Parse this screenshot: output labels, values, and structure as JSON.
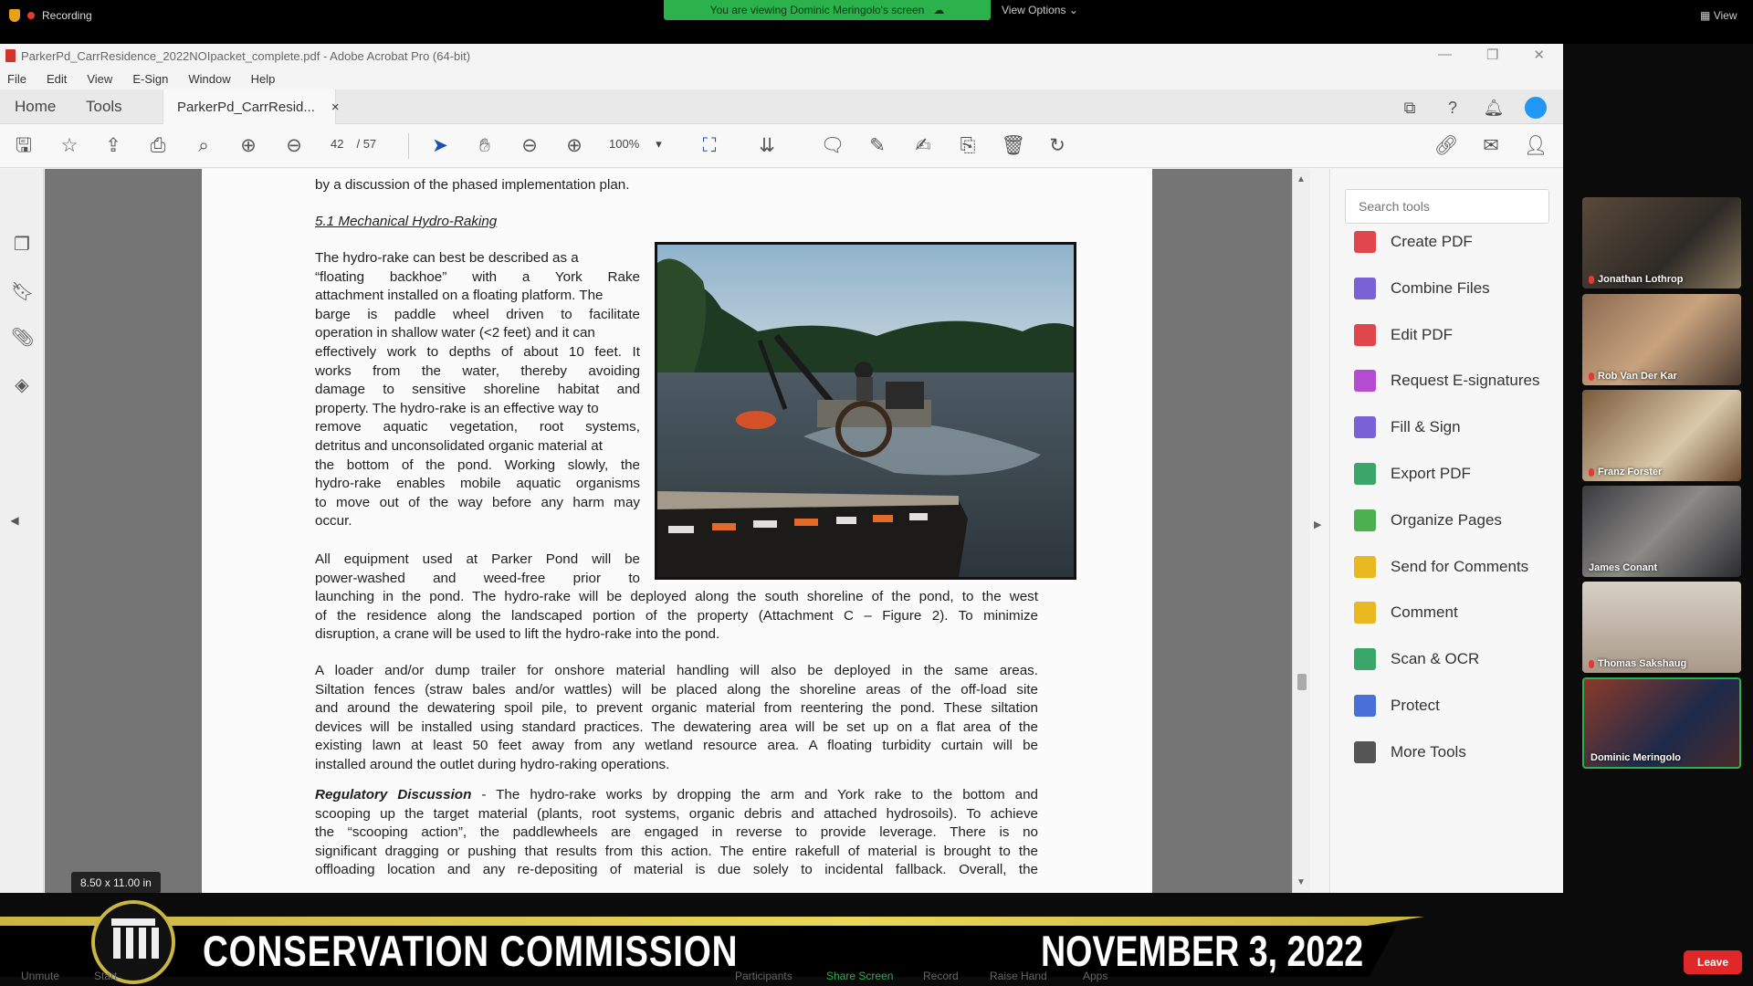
{
  "zoom": {
    "recording_label": "Recording",
    "viewing_banner": "You are viewing Dominic Meringolo's screen",
    "view_options": "View Options",
    "view": "View",
    "controls": [
      "Unmute",
      "Start",
      "Participants",
      "Share Screen",
      "Record",
      "Raise Hand",
      "Apps"
    ],
    "leave_label": "Leave",
    "participants": [
      {
        "name": "Jonathan Lothrop"
      },
      {
        "name": "Rob Van Der Kar"
      },
      {
        "name": "Franz Forster"
      },
      {
        "name": "James Conant"
      },
      {
        "name": "Thomas Sakshaug"
      },
      {
        "name": "Dominic Meringolo"
      }
    ],
    "colors": {
      "viewing_green": "#2bb24c",
      "leave_red": "#e02828",
      "muted_red": "#e53935"
    }
  },
  "acrobat": {
    "window_title": "ParkerPd_CarrResidence_2022NOIpacket_complete.pdf - Adobe Acrobat Pro (64-bit)",
    "menu": [
      "File",
      "Edit",
      "View",
      "E-Sign",
      "Window",
      "Help"
    ],
    "tabs": {
      "home": "Home",
      "tools": "Tools",
      "document": "ParkerPd_CarrResid...",
      "close": "×"
    },
    "page_current": "42",
    "page_total": "/  57",
    "zoom_level": "100%",
    "page_size_tooltip": "8.50 x 11.00 in",
    "tools_search_placeholder": "Search tools",
    "tools": [
      {
        "label": "Create PDF",
        "icon": "create-pdf-icon",
        "color": "#e0474c"
      },
      {
        "label": "Combine Files",
        "icon": "combine-files-icon",
        "color": "#7b61d6"
      },
      {
        "label": "Edit PDF",
        "icon": "edit-pdf-icon",
        "color": "#e0474c"
      },
      {
        "label": "Request E-signatures",
        "icon": "request-esign-icon",
        "color": "#b44bd0"
      },
      {
        "label": "Fill & Sign",
        "icon": "fill-sign-icon",
        "color": "#7b61d6"
      },
      {
        "label": "Export PDF",
        "icon": "export-pdf-icon",
        "color": "#3aa66a"
      },
      {
        "label": "Organize Pages",
        "icon": "organize-pages-icon",
        "color": "#4caf50"
      },
      {
        "label": "Send for Comments",
        "icon": "send-comments-icon",
        "color": "#e8b820"
      },
      {
        "label": "Comment",
        "icon": "comment-icon",
        "color": "#e8b820"
      },
      {
        "label": "Scan & OCR",
        "icon": "scan-ocr-icon",
        "color": "#3aa66a"
      },
      {
        "label": "Protect",
        "icon": "protect-icon",
        "color": "#4a6fd6"
      },
      {
        "label": "More Tools",
        "icon": "more-tools-icon",
        "color": "#555555"
      }
    ]
  },
  "document": {
    "partial_top": "by a discussion of the phased implementation plan.",
    "heading": "5.1 Mechanical Hydro-Raking",
    "para1_lines": [
      "The hydro-rake can best be described as a",
      "“floating backhoe” with a York Rake",
      "attachment installed on a floating platform. The",
      "barge is paddle wheel driven to facilitate",
      "operation in shallow water (<2 feet) and it can",
      "effectively work to depths of about 10 feet. It",
      "works from the water, thereby avoiding",
      "damage to sensitive shoreline habitat and",
      "property. The hydro-rake is an effective way to",
      "remove aquatic vegetation, root systems,",
      "detritus and unconsolidated organic material at",
      "the bottom of the pond. Working slowly, the",
      "hydro-rake enables mobile aquatic organisms",
      "to move out of the way before any harm may",
      "occur."
    ],
    "para2_short_lines": [
      "All equipment used at Parker Pond will be",
      "power-washed and weed-free prior to"
    ],
    "para2_full_lines": [
      "launching in the pond. The hydro-rake will be deployed along the south shoreline of the pond, to the west",
      "of the residence along the landscaped portion of the property (Attachment C – Figure 2). To minimize",
      "disruption, a crane will be used to lift the hydro-rake into the pond."
    ],
    "para3_lines": [
      "A loader and/or dump trailer for onshore material handling will also be deployed in the same areas.",
      "Siltation fences (straw bales and/or wattles) will be placed along the shoreline areas of the off-load site",
      "and around the dewatering spoil pile, to prevent organic material from reentering the pond. These siltation",
      "devices will be installed using standard practices. The dewatering area will be set up on a flat area of the",
      "existing lawn at least 50 feet away from any wetland resource area. A floating turbidity curtain will be",
      "installed around the outlet during hydro-raking operations."
    ],
    "para4_lead": "Regulatory Discussion",
    "para4_first_rest": " - The hydro-rake works by dropping the arm and York rake to the bottom and",
    "para4_lines": [
      "scooping up the target material (plants, root systems, organic debris and attached hydrosoils). To achieve",
      "the “scooping action”, the paddlewheels are engaged in reverse to provide leverage. There is no",
      "significant dragging or pushing that results from this action. The entire rakefull of material is brought to the",
      "offloading location and any re-depositing of material is due solely to incidental fallback. Overall, the"
    ]
  },
  "banner": {
    "title": "CONSERVATION COMMISSION",
    "date": "NOVEMBER 3, 2022",
    "accent": "#c9b541"
  }
}
